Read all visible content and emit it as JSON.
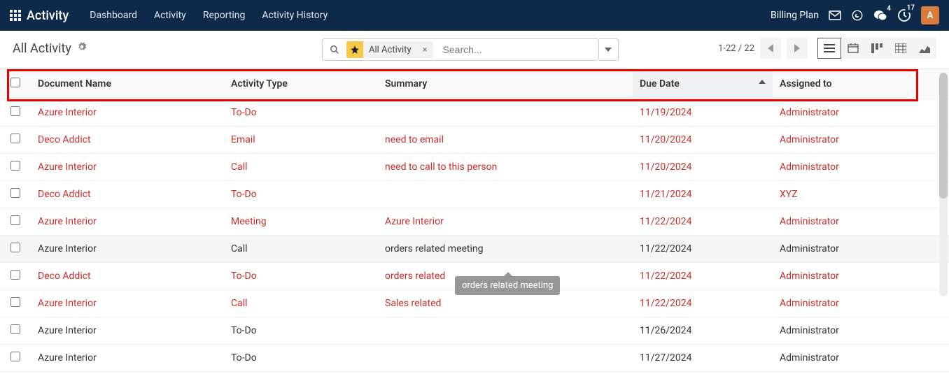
{
  "nav": {
    "brand": "Activity",
    "links": [
      "Dashboard",
      "Activity",
      "Reporting",
      "Activity History"
    ],
    "billing": "Billing Plan",
    "chat_count": "4",
    "clock_count": "17",
    "avatar_letter": "A"
  },
  "control": {
    "title": "All Activity",
    "search_facet": "All Activity",
    "search_placeholder": "Search...",
    "pager_text": "1-22 / 22"
  },
  "table": {
    "headers": {
      "doc": "Document Name",
      "type": "Activity Type",
      "summary": "Summary",
      "due": "Due Date",
      "assigned": "Assigned to"
    },
    "rows": [
      {
        "doc": "Azure Interior",
        "type": "To-Do",
        "summary": "",
        "due": "11/19/2024",
        "assn": "Administrator",
        "red": true,
        "hover": false
      },
      {
        "doc": "Deco Addict",
        "type": "Email",
        "summary": "need to email",
        "due": "11/20/2024",
        "assn": "Administrator",
        "red": true,
        "hover": false
      },
      {
        "doc": "Azure Interior",
        "type": "Call",
        "summary": "need to call to this person",
        "due": "11/20/2024",
        "assn": "Administrator",
        "red": true,
        "hover": false
      },
      {
        "doc": "Deco Addict",
        "type": "To-Do",
        "summary": "",
        "due": "11/21/2024",
        "assn": "XYZ",
        "red": true,
        "hover": false
      },
      {
        "doc": "Azure Interior",
        "type": "Meeting",
        "summary": "Azure Interior",
        "due": "11/22/2024",
        "assn": "Administrator",
        "red": true,
        "hover": false
      },
      {
        "doc": "Azure Interior",
        "type": "Call",
        "summary": "orders related meeting",
        "due": "11/22/2024",
        "assn": "Administrator",
        "red": false,
        "hover": true
      },
      {
        "doc": "Deco Addict",
        "type": "To-Do",
        "summary": "orders related",
        "due": "11/22/2024",
        "assn": "Administrator",
        "red": true,
        "hover": false
      },
      {
        "doc": "Azure Interior",
        "type": "Call",
        "summary": "Sales related",
        "due": "11/22/2024",
        "assn": "Administrator",
        "red": true,
        "hover": false
      },
      {
        "doc": "Azure Interior",
        "type": "To-Do",
        "summary": "",
        "due": "11/26/2024",
        "assn": "Administrator",
        "red": false,
        "hover": false
      },
      {
        "doc": "Azure Interior",
        "type": "To-Do",
        "summary": "",
        "due": "11/27/2024",
        "assn": "Administrator",
        "red": false,
        "hover": false
      }
    ]
  },
  "tooltip": "orders related meeting"
}
